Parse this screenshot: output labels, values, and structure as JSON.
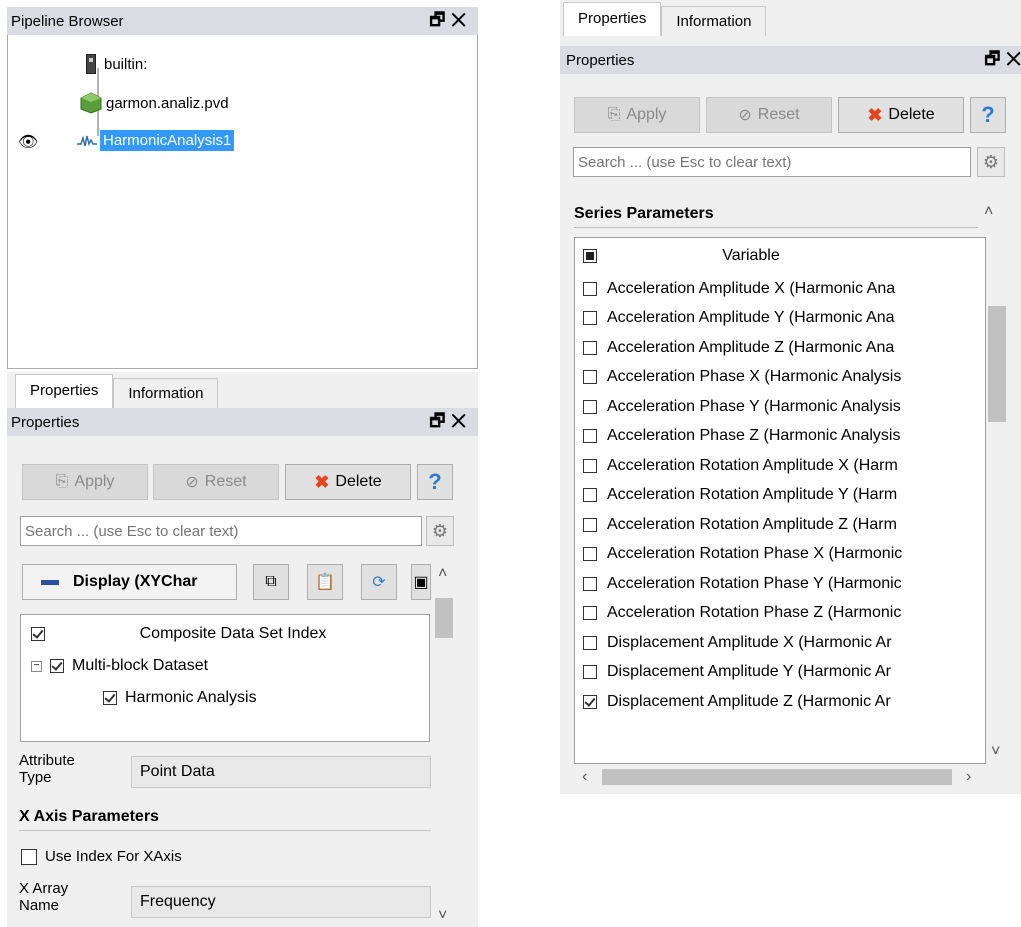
{
  "pipeline": {
    "title": "Pipeline Browser",
    "items": [
      {
        "label": "builtin:"
      },
      {
        "label": "garmon.analiz.pvd"
      },
      {
        "label": "HarmonicAnalysis1"
      }
    ]
  },
  "window_controls": {
    "float_icon": "float-icon",
    "close_icon": "close-icon"
  },
  "left_props": {
    "tabs": [
      "Properties",
      "Information"
    ],
    "title": "Properties",
    "buttons": {
      "apply": "Apply",
      "reset": "Reset",
      "delete": "Delete",
      "help": "?"
    },
    "search_placeholder": "Search ... (use Esc to clear text)",
    "display_label": "Display (XYChar",
    "composite_header": "Composite Data Set Index",
    "tree": {
      "root": "Multi-block Dataset",
      "child": "Harmonic Analysis"
    },
    "attribute_type_label": "Attribute Type",
    "attribute_type_value": "Point Data",
    "x_axis_section": "X Axis Parameters",
    "use_index_label": "Use Index For XAxis",
    "x_array_label": "X Array Name",
    "x_array_value": "Frequency"
  },
  "right_props": {
    "tabs": [
      "Properties",
      "Information"
    ],
    "title": "Properties",
    "buttons": {
      "apply": "Apply",
      "reset": "Reset",
      "delete": "Delete",
      "help": "?"
    },
    "search_placeholder": "Search ... (use Esc to clear text)",
    "series_section": "Series Parameters",
    "variable_header": "Variable",
    "series": [
      {
        "label": "Acceleration Amplitude X (Harmonic Ana",
        "checked": false
      },
      {
        "label": "Acceleration Amplitude Y (Harmonic Ana",
        "checked": false
      },
      {
        "label": "Acceleration Amplitude Z (Harmonic Ana",
        "checked": false
      },
      {
        "label": "Acceleration Phase X (Harmonic Analysis",
        "checked": false
      },
      {
        "label": "Acceleration Phase Y (Harmonic Analysis",
        "checked": false
      },
      {
        "label": "Acceleration Phase Z (Harmonic Analysis",
        "checked": false
      },
      {
        "label": "Acceleration Rotation Amplitude X (Harm",
        "checked": false
      },
      {
        "label": "Acceleration Rotation Amplitude Y (Harm",
        "checked": false
      },
      {
        "label": "Acceleration Rotation Amplitude Z (Harm",
        "checked": false
      },
      {
        "label": "Acceleration Rotation Phase X (Harmonic",
        "checked": false
      },
      {
        "label": "Acceleration Rotation Phase Y (Harmonic",
        "checked": false
      },
      {
        "label": "Acceleration Rotation Phase Z (Harmonic",
        "checked": false
      },
      {
        "label": "Displacement Amplitude X (Harmonic Ar",
        "checked": false
      },
      {
        "label": "Displacement Amplitude Y (Harmonic Ar",
        "checked": false
      },
      {
        "label": "Displacement Amplitude Z (Harmonic Ar",
        "checked": true
      }
    ]
  },
  "colors": {
    "selection": "#3399ff",
    "titlebar": "#d9dde3",
    "delete_x": "#e8431f",
    "help": "#2e7bd6"
  }
}
